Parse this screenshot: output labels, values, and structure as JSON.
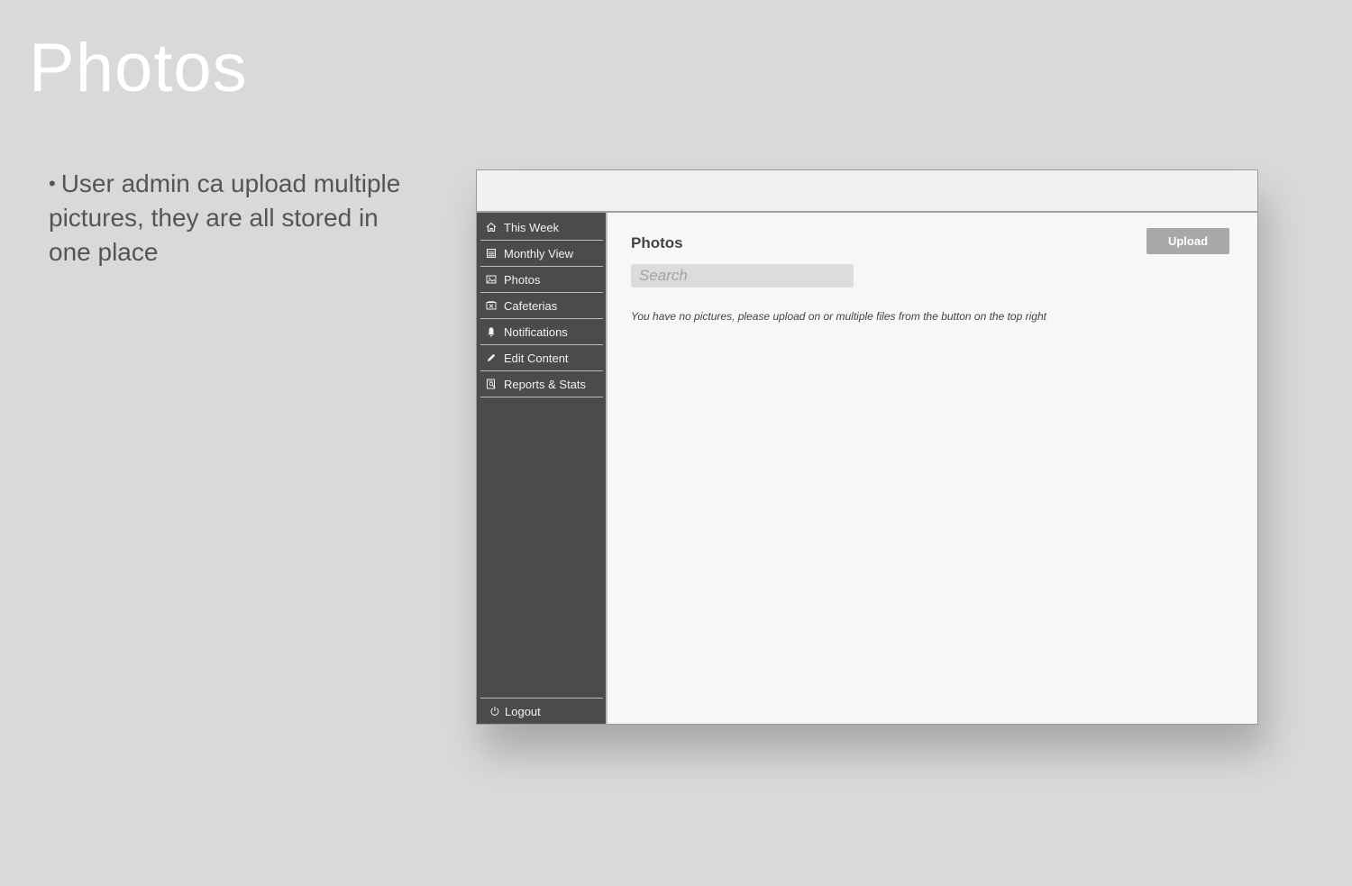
{
  "slide": {
    "title": "Photos",
    "bullet_symbol": "•",
    "bullet": "User admin ca upload multiple pictures, they are all stored in one place"
  },
  "sidebar": {
    "items": [
      {
        "label": "This Week",
        "icon": "home-icon"
      },
      {
        "label": "Monthly View",
        "icon": "calendar-icon"
      },
      {
        "label": "Photos",
        "icon": "image-icon"
      },
      {
        "label": "Cafeterias",
        "icon": "cafeteria-icon"
      },
      {
        "label": "Notifications",
        "icon": "bell-icon"
      },
      {
        "label": "Edit Content",
        "icon": "pencil-icon"
      },
      {
        "label": "Reports & Stats",
        "icon": "report-icon"
      }
    ],
    "logout": {
      "label": "Logout",
      "icon": "power-icon"
    }
  },
  "main": {
    "title": "Photos",
    "search_placeholder": "Search",
    "upload_label": "Upload",
    "empty_message": "You have no pictures, please upload on or multiple files from the button on the top right"
  },
  "colors": {
    "background": "#d9d9d9",
    "sidebar": "#4b4b4b",
    "upload_button": "#a8a8a8",
    "content": "#f7f7f7"
  }
}
